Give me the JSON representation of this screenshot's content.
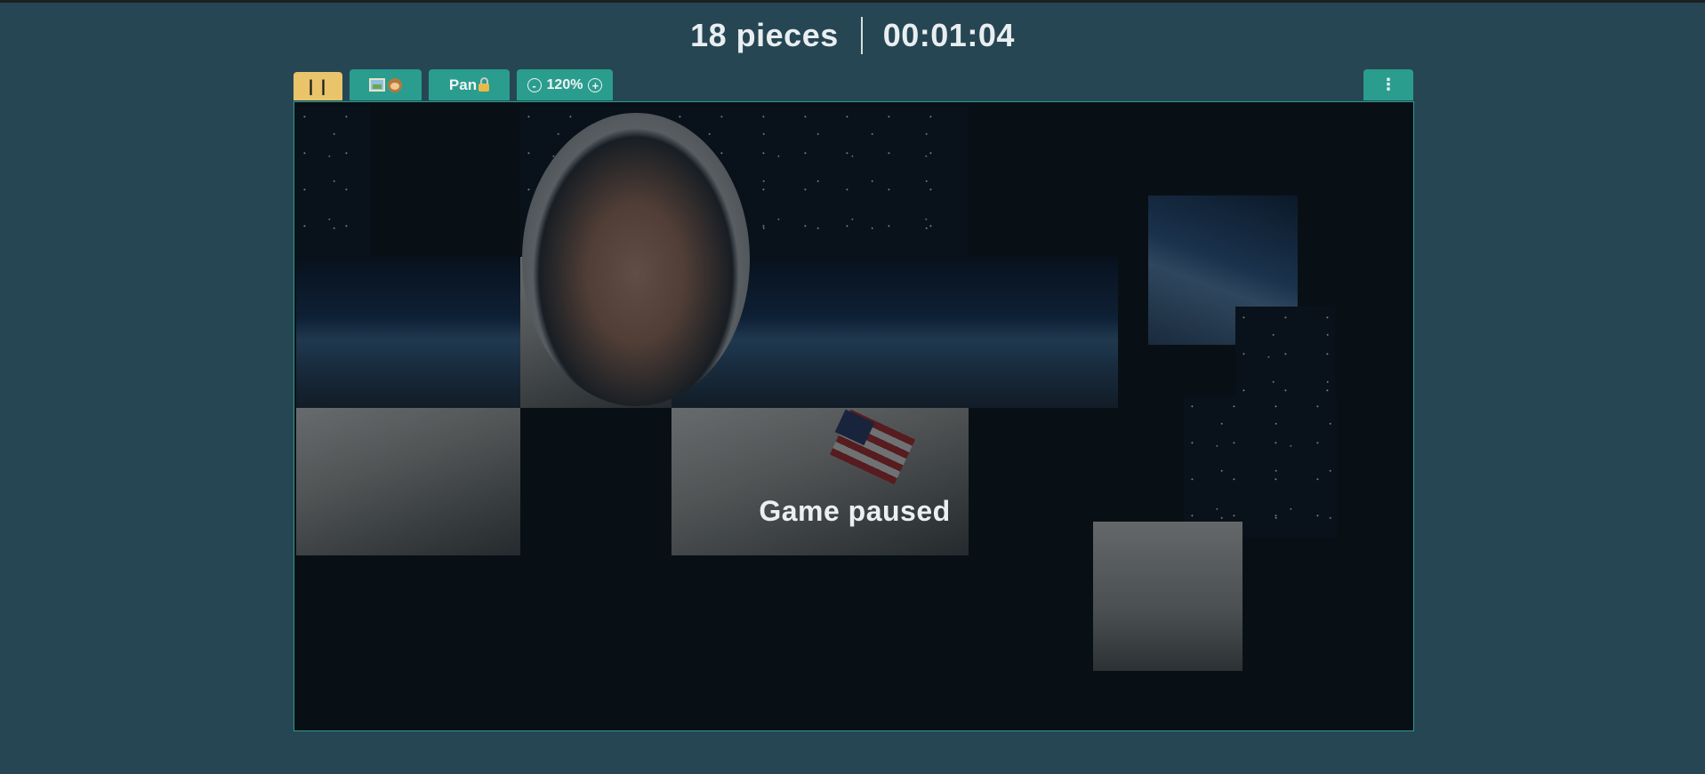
{
  "header": {
    "pieces_label": "18 pieces",
    "timer": "00:01:04"
  },
  "toolbar": {
    "pause_label": "| |",
    "preview_icons": [
      "picture-icon",
      "see-no-evil-monkey-icon"
    ],
    "pan_label": "Pan",
    "pan_icon": "lock-icon",
    "zoom_minus": "-",
    "zoom_level": "120%",
    "zoom_plus": "+",
    "menu_label": "⋮"
  },
  "board": {
    "status_text": "Game paused",
    "border_color": "#2a9d8f",
    "background_color": "#0a1116"
  },
  "colors": {
    "page_bg": "#264653",
    "accent_teal": "#2a9d8f",
    "pause_yellow": "#e9c46a"
  }
}
